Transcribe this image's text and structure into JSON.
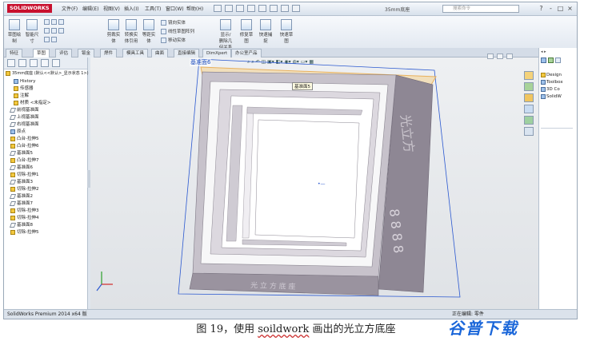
{
  "app": {
    "logo_text": "SOLIDWORKS",
    "menus": [
      "文件(F)",
      "编辑(E)",
      "视图(V)",
      "插入(I)",
      "工具(T)",
      "窗口(W)",
      "帮助(H)"
    ],
    "document_title": "35mm底座",
    "search_placeholder": "搜索命令",
    "window_controls": [
      "?",
      "-",
      "□",
      "×"
    ]
  },
  "ribbon": {
    "big_buttons": [
      "草图绘制",
      "智能尺寸",
      "剪裁实体",
      "转换实体引用",
      "等距实体",
      "镜向实体",
      "显示/删除几何关系",
      "修复草图",
      "快速捕捉",
      "快速草图"
    ],
    "small_buttons": [
      "镜向实体",
      "线性草图阵列",
      "移动实体"
    ]
  },
  "tabs": [
    "特征",
    "草图",
    "评估",
    "DimXpert",
    "办公室产品"
  ],
  "tabs_extra": [
    "钣金",
    "焊件",
    "模具工具",
    "曲面",
    "直接编辑"
  ],
  "feature_tree": {
    "root": "35mm底座 (默认<<默认>_显示状态 1>)",
    "items": [
      {
        "label": "History",
        "icon": "history-icon"
      },
      {
        "label": "传感器",
        "icon": "sensor-icon"
      },
      {
        "label": "注解",
        "icon": "annotation-icon"
      },
      {
        "label": "材质 <未指定>",
        "icon": "material-icon"
      },
      {
        "label": "前视基准面",
        "icon": "plane-icon"
      },
      {
        "label": "上视基准面",
        "icon": "plane-icon"
      },
      {
        "label": "右视基准面",
        "icon": "plane-icon"
      },
      {
        "label": "原点",
        "icon": "origin-icon"
      },
      {
        "label": "凸台-拉伸5",
        "icon": "feature-icon"
      },
      {
        "label": "凸台-拉伸6",
        "icon": "feature-icon"
      },
      {
        "label": "基准面5",
        "icon": "plane-icon"
      },
      {
        "label": "凸台-拉伸7",
        "icon": "feature-icon"
      },
      {
        "label": "基准面6",
        "icon": "plane-icon"
      },
      {
        "label": "切除-拉伸1",
        "icon": "feature-icon"
      },
      {
        "label": "基准面3",
        "icon": "plane-icon"
      },
      {
        "label": "切除-拉伸2",
        "icon": "feature-icon"
      },
      {
        "label": "基准面2",
        "icon": "plane-icon"
      },
      {
        "label": "基准面7",
        "icon": "plane-icon"
      },
      {
        "label": "切除-拉伸3",
        "icon": "feature-icon"
      },
      {
        "label": "切除-拉伸4",
        "icon": "feature-icon"
      },
      {
        "label": "基准面8",
        "icon": "plane-icon"
      },
      {
        "label": "切除-拉伸5",
        "icon": "feature-icon"
      }
    ]
  },
  "viewport": {
    "plane_label": "基准面6",
    "tooltip": "基准面5",
    "side_text": "光立方",
    "side_digits": "8 8 8 8",
    "front_text": "光 立 方 底 座"
  },
  "right_panel": {
    "items": [
      "Design",
      "Toolbox",
      "3D Co",
      "SolidW"
    ]
  },
  "statusbar": {
    "left": "SolidWorks Premium 2014 x64 版",
    "right": "正在编辑: 零件"
  },
  "caption": {
    "prefix": "图 19，使用 ",
    "underlined": "soildwork",
    "suffix": " 画出的光立方底座"
  },
  "watermark": "谷普下载",
  "colors": {
    "accent_blue": "#1f5fd6",
    "plane_orange": "#e8a23a",
    "model_face": "#8e8794",
    "watermark_blue": "#1a66d9"
  }
}
